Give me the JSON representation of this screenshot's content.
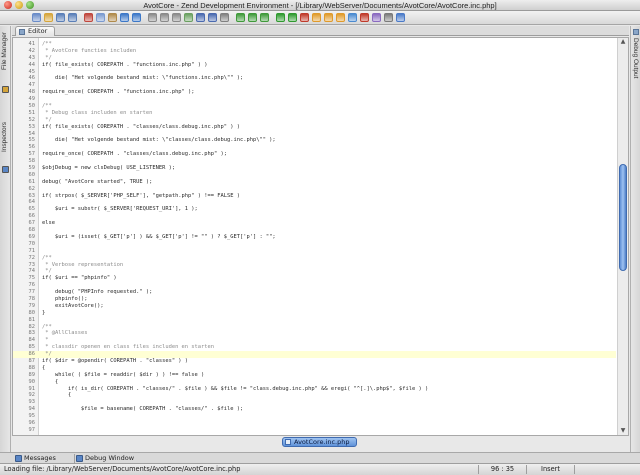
{
  "window": {
    "title": "AvotCore - Zend Development Environment - [/Library/WebServer/Documents/AvotCore/AvotCore.inc.php]"
  },
  "toolbar": {
    "buttons": [
      "new-file-icon",
      "open-icon",
      "save-icon",
      "save-all-icon",
      "cut-icon",
      "copy-icon",
      "paste-icon",
      "undo-icon",
      "redo-icon",
      "find-icon",
      "find-next-icon",
      "replace-icon",
      "goto-line-icon",
      "indent-icon",
      "outdent-icon",
      "comment-icon",
      "bookmark-icon",
      "prev-bookmark-icon",
      "next-bookmark-icon",
      "run-icon",
      "debug-icon",
      "stop-icon",
      "step-into-icon",
      "step-over-icon",
      "step-out-icon",
      "run-to-cursor-icon",
      "breakpoint-icon",
      "watch-icon",
      "profile-icon",
      "help-icon"
    ],
    "colors": [
      "#6a8cc8",
      "#d6a53a",
      "#5a7fb8",
      "#5a7fb8",
      "#c0463c",
      "#7a9ad0",
      "#b08a4a",
      "#3c78c8",
      "#3c78c8",
      "#8a8a8a",
      "#8a8a8a",
      "#8a8a8a",
      "#6aa060",
      "#4a6ab0",
      "#4a6ab0",
      "#808080",
      "#3f9a3a",
      "#3f9a3a",
      "#3f9a3a",
      "#2f9a2f",
      "#2f9a2f",
      "#c03a2a",
      "#e09a2a",
      "#e09a2a",
      "#e09a2a",
      "#4a8ad0",
      "#c03a2a",
      "#8a6ac0",
      "#7a7a7a",
      "#4a7ac8"
    ]
  },
  "left_rail": {
    "tabs": [
      {
        "label": "File Manager",
        "icon": "folder-icon",
        "color": "#d4a43a"
      },
      {
        "label": "Inspectors",
        "icon": "inspector-icon",
        "color": "#5a86c6"
      }
    ]
  },
  "right_rail": {
    "label": "Debug Output"
  },
  "editor": {
    "tab_label": "Editor",
    "current_line": 86,
    "lines": [
      {
        "n": "41",
        "t": "/**",
        "k": "cmt"
      },
      {
        "n": "42",
        "t": " * AvotCore functies includen",
        "k": "cmt"
      },
      {
        "n": "43",
        "t": " */",
        "k": "cmt"
      },
      {
        "n": "44",
        "t": "if( file_exists( COREPATH . \"functions.inc.php\" ) )",
        "k": ""
      },
      {
        "n": "45",
        "t": "",
        "k": ""
      },
      {
        "n": "46",
        "t": "    die( \"Het volgende bestand mist: \\\"functions.inc.php\\\"\" );",
        "k": ""
      },
      {
        "n": "47",
        "t": "",
        "k": ""
      },
      {
        "n": "48",
        "t": "require_once( COREPATH . \"functions.inc.php\" );",
        "k": ""
      },
      {
        "n": "49",
        "t": "",
        "k": ""
      },
      {
        "n": "50",
        "t": "/**",
        "k": "cmt"
      },
      {
        "n": "51",
        "t": " * Debug class includen en starten",
        "k": "cmt"
      },
      {
        "n": "52",
        "t": " */",
        "k": "cmt"
      },
      {
        "n": "53",
        "t": "if( file_exists( COREPATH . \"classes/class.debug.inc.php\" ) )",
        "k": ""
      },
      {
        "n": "54",
        "t": "",
        "k": ""
      },
      {
        "n": "55",
        "t": "    die( \"Het volgende bestand mist: \\\"classes/class.debug.inc.php\\\"\" );",
        "k": ""
      },
      {
        "n": "56",
        "t": "",
        "k": ""
      },
      {
        "n": "57",
        "t": "require_once( COREPATH . \"classes/class.debug.inc.php\" );",
        "k": ""
      },
      {
        "n": "58",
        "t": "",
        "k": ""
      },
      {
        "n": "59",
        "t": "$objDebug = new clsDebug( USE_LISTENER );",
        "k": ""
      },
      {
        "n": "60",
        "t": "",
        "k": ""
      },
      {
        "n": "61",
        "t": "debug( \"AvotCore started\", TRUE );",
        "k": ""
      },
      {
        "n": "62",
        "t": "",
        "k": ""
      },
      {
        "n": "63",
        "t": "if( strpos( $_SERVER['PHP_SELF'], \"getpath.php\" ) !== FALSE )",
        "k": ""
      },
      {
        "n": "64",
        "t": "",
        "k": ""
      },
      {
        "n": "65",
        "t": "    $uri = substr( $_SERVER['REQUEST_URI'], 1 );",
        "k": ""
      },
      {
        "n": "66",
        "t": "",
        "k": ""
      },
      {
        "n": "67",
        "t": "else",
        "k": ""
      },
      {
        "n": "68",
        "t": "",
        "k": ""
      },
      {
        "n": "69",
        "t": "    $uri = (isset( $_GET['p'] ) && $_GET['p'] != \"\" ) ? $_GET['p'] : \"\";",
        "k": ""
      },
      {
        "n": "70",
        "t": "",
        "k": ""
      },
      {
        "n": "71",
        "t": "",
        "k": ""
      },
      {
        "n": "72",
        "t": "/**",
        "k": "cmt"
      },
      {
        "n": "73",
        "t": " * Verbose representation",
        "k": "cmt"
      },
      {
        "n": "74",
        "t": " */",
        "k": "cmt"
      },
      {
        "n": "75",
        "t": "if( $uri == \"phpinfo\" )",
        "k": ""
      },
      {
        "n": "76",
        "t": "",
        "k": ""
      },
      {
        "n": "77",
        "t": "    debug( \"PHPInfo requested.\" );",
        "k": ""
      },
      {
        "n": "78",
        "t": "    phpinfo();",
        "k": ""
      },
      {
        "n": "79",
        "t": "    exitAvotCore();",
        "k": ""
      },
      {
        "n": "80",
        "t": "}",
        "k": ""
      },
      {
        "n": "81",
        "t": "",
        "k": ""
      },
      {
        "n": "82",
        "t": "/**",
        "k": "cmt"
      },
      {
        "n": "83",
        "t": " * @AllClasses",
        "k": "cmt"
      },
      {
        "n": "84",
        "t": " *",
        "k": "cmt"
      },
      {
        "n": "85",
        "t": " * classdir openen en class files includen en starten",
        "k": "cmt"
      },
      {
        "n": "86",
        "t": " */",
        "k": "cmt"
      },
      {
        "n": "87",
        "t": "if( $dir = @opendir( COREPATH . \"classes\" ) )",
        "k": ""
      },
      {
        "n": "88",
        "t": "{",
        "k": ""
      },
      {
        "n": "89",
        "t": "    while( ( $file = readdir( $dir ) ) !== false )",
        "k": ""
      },
      {
        "n": "90",
        "t": "    {",
        "k": ""
      },
      {
        "n": "91",
        "t": "        if( is_dir( COREPATH . \"classes/\" . $file ) && $file != \"class.debug.inc.php\" && eregi( \"^[.]\\.php$\", $file ) )",
        "k": ""
      },
      {
        "n": "92",
        "t": "        {",
        "k": ""
      },
      {
        "n": "93",
        "t": "",
        "k": ""
      },
      {
        "n": "94",
        "t": "            $file = basename( COREPATH . \"classes/\" . $file );",
        "k": ""
      },
      {
        "n": "95",
        "t": "",
        "k": ""
      },
      {
        "n": "96",
        "t": "",
        "k": ""
      },
      {
        "n": "97",
        "t": "",
        "k": ""
      }
    ],
    "scroll": {
      "thumb_start": 0.31,
      "thumb_end": 0.59
    }
  },
  "document_tab": {
    "label": "AvotCore.inc.php"
  },
  "bottom_tabs": [
    {
      "label": "Messages",
      "icon": "messages-icon",
      "color": "#5a86c6"
    },
    {
      "label": "Debug Window",
      "icon": "debug-window-icon",
      "color": "#5a86c6"
    }
  ],
  "status": {
    "message": "Loading file: /Library/WebServer/Documents/AvotCore/AvotCore.inc.php",
    "position": "96 : 35",
    "mode": "Insert"
  }
}
